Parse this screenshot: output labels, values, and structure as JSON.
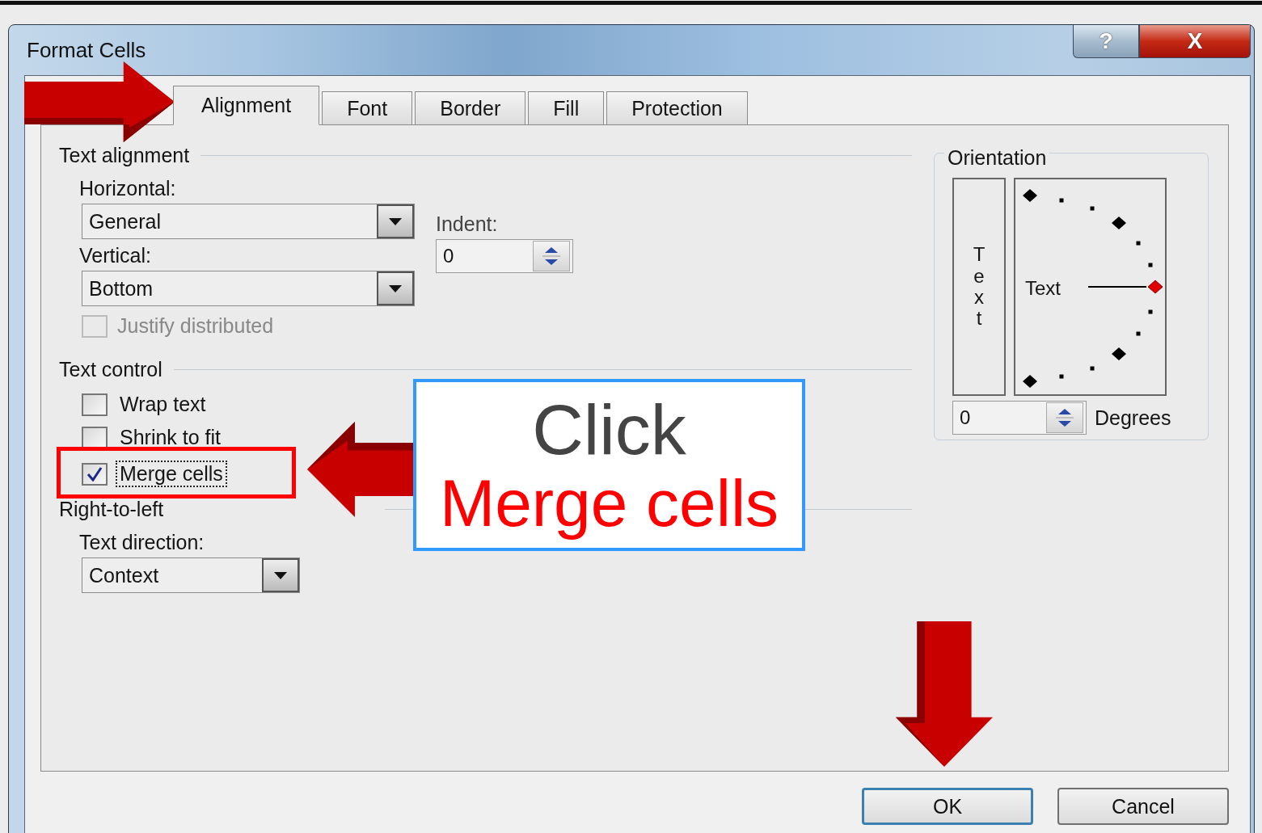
{
  "window": {
    "title": "Format Cells",
    "help_button": "?",
    "close_button": "X"
  },
  "tabs": [
    {
      "label": "Alignment",
      "selected": true
    },
    {
      "label": "Font",
      "selected": false
    },
    {
      "label": "Border",
      "selected": false
    },
    {
      "label": "Fill",
      "selected": false
    },
    {
      "label": "Protection",
      "selected": false
    }
  ],
  "text_alignment": {
    "title": "Text alignment",
    "horizontal": {
      "label": "Horizontal:",
      "value": "General"
    },
    "vertical": {
      "label": "Vertical:",
      "value": "Bottom"
    },
    "indent": {
      "label": "Indent:",
      "value": "0"
    },
    "justify_distributed": {
      "label": "Justify distributed",
      "checked": false,
      "disabled": true
    }
  },
  "text_control": {
    "title": "Text control",
    "options": [
      {
        "label": "Wrap text",
        "checked": false,
        "focused": false
      },
      {
        "label": "Shrink to fit",
        "checked": false,
        "focused": false
      },
      {
        "label": "Merge cells",
        "checked": true,
        "focused": true
      }
    ]
  },
  "right_to_left": {
    "title": "Right-to-left",
    "text_direction": {
      "label": "Text direction:",
      "value": "Context"
    }
  },
  "orientation": {
    "title": "Orientation",
    "vertical_text": "Text",
    "dial_text": "Text",
    "degrees": {
      "value": "0",
      "label": "Degrees"
    }
  },
  "buttons": [
    {
      "label": "OK",
      "default": true
    },
    {
      "label": "Cancel",
      "default": false
    }
  ],
  "callout": {
    "lines": [
      {
        "text": "Click",
        "color": "#444444"
      },
      {
        "text": "Merge cells",
        "color": "#ff0000"
      }
    ]
  }
}
